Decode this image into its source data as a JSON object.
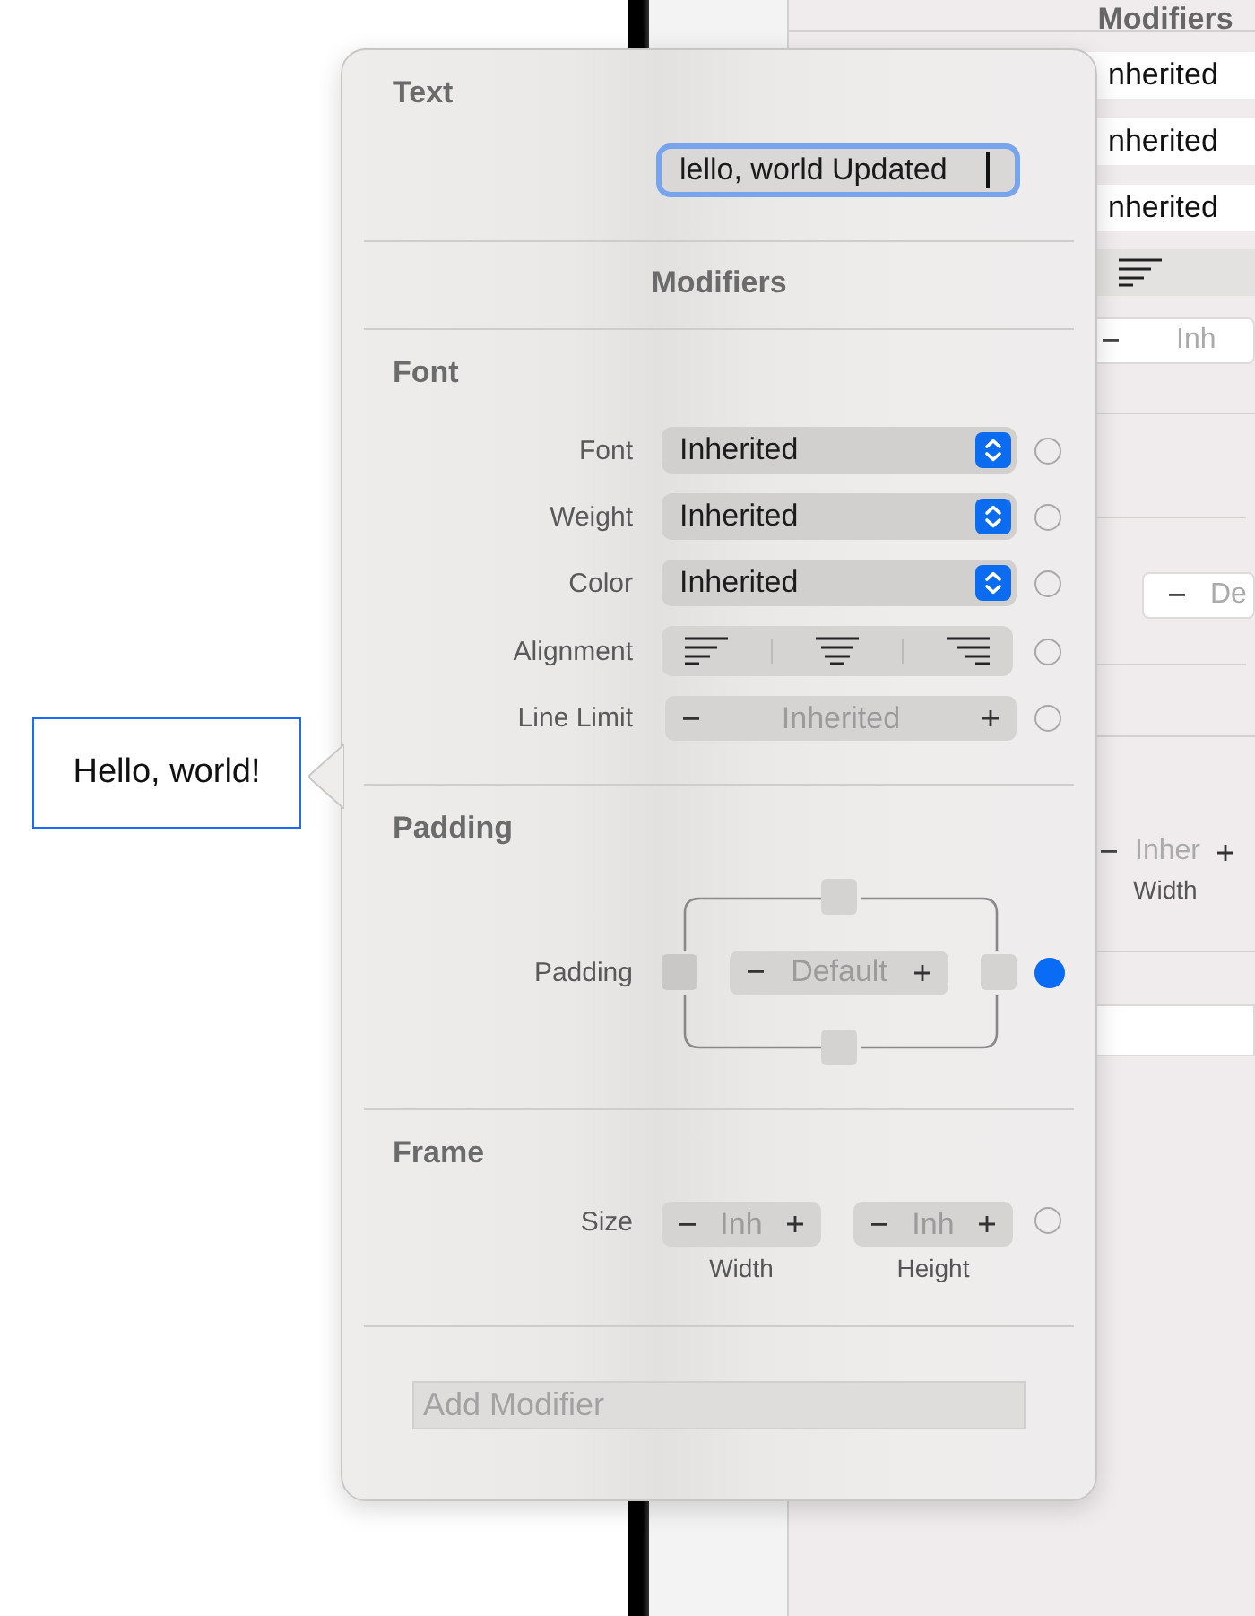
{
  "canvas": {
    "preview_text": "Hello, world!",
    "selected": true
  },
  "background_inspector": {
    "heading": "Modifiers",
    "pickers": [
      "nherited",
      "nherited",
      "nherited"
    ],
    "line_limit_value": "Inh",
    "padding_value": "De",
    "width_value": "Inher",
    "width_caption": "Width"
  },
  "popover": {
    "text_section": {
      "title": "Text",
      "value": "lello, world Updated",
      "focused": true
    },
    "modifiers_title": "Modifiers",
    "sections": [
      {
        "title": "Font",
        "rows": [
          {
            "kind": "picker",
            "label": "Font",
            "value": "Inherited",
            "active": false
          },
          {
            "kind": "picker",
            "label": "Weight",
            "value": "Inherited",
            "active": false
          },
          {
            "kind": "picker",
            "label": "Color",
            "value": "Inherited",
            "active": false
          },
          {
            "kind": "alignment",
            "label": "Alignment",
            "active": false
          },
          {
            "kind": "stepper",
            "label": "Line Limit",
            "value": "Inherited",
            "active": false
          }
        ]
      },
      {
        "title": "Padding",
        "rows": [
          {
            "kind": "padding",
            "label": "Padding",
            "value": "Default",
            "active": true
          }
        ]
      },
      {
        "title": "Frame",
        "rows": [
          {
            "kind": "size",
            "label": "Size",
            "fields": [
              {
                "value": "Inh",
                "caption": "Width"
              },
              {
                "value": "Inh",
                "caption": "Height"
              }
            ],
            "active": false
          }
        ]
      }
    ],
    "add_modifier": {
      "placeholder": "Add Modifier"
    }
  }
}
